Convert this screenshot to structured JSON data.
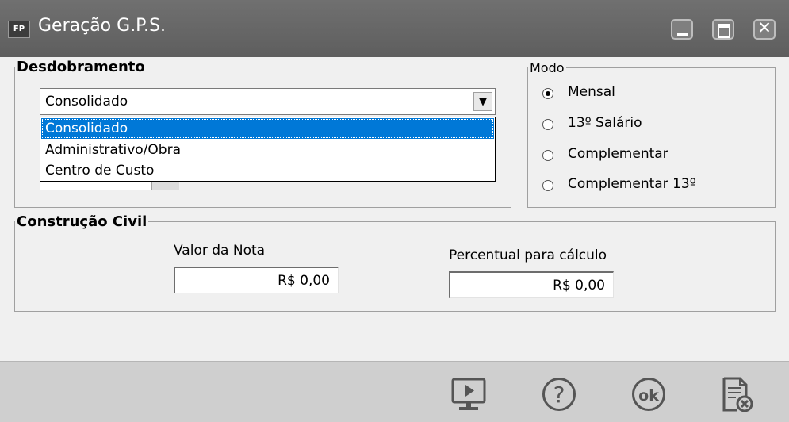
{
  "window": {
    "title": "Geração G.P.S.",
    "app_icon": "FP",
    "minimize_icon": "minimize-icon",
    "maximize_icon": "maximize-icon",
    "close_icon": "close-icon"
  },
  "desdobramento": {
    "legend": "Desdobramento",
    "selected": "Consolidado",
    "options": [
      "Consolidado",
      "Administrativo/Obra",
      "Centro de Custo"
    ],
    "highlighted_index": 0
  },
  "modo": {
    "legend": "Modo",
    "options": [
      {
        "label": "Mensal",
        "checked": true
      },
      {
        "label": "13º Salário",
        "checked": false
      },
      {
        "label": "Complementar",
        "checked": false
      },
      {
        "label": "Complementar 13º",
        "checked": false
      }
    ]
  },
  "construcao_civil": {
    "legend": "Construção Civil",
    "valor_nota_label": "Valor da Nota",
    "valor_nota_value": "R$ 0,00",
    "percentual_label": "Percentual para cálculo",
    "percentual_value": "R$ 0,00"
  },
  "footer": {
    "buttons": [
      "preview-icon",
      "help-icon",
      "ok-icon",
      "cancel-report-icon"
    ],
    "ok_text": "ok",
    "help_text": "?"
  },
  "colors": {
    "titlebar": "#646464",
    "selection": "#0078d7",
    "footer": "#cfcfcf",
    "icon_gray": "#555555"
  }
}
